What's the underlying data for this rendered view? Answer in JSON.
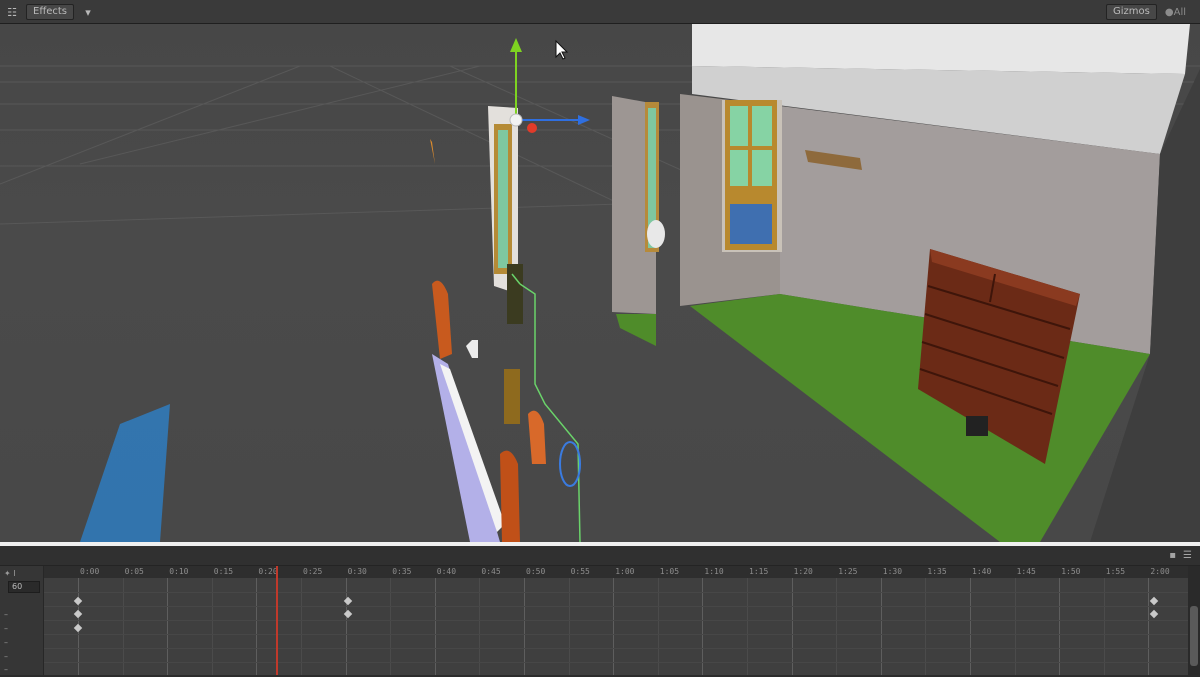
{
  "toolbar": {
    "effects_label": "Effects",
    "layers_label": "Gizmos",
    "search_placeholder": "●All"
  },
  "timeline": {
    "frame_value": "60",
    "ticks": [
      "0:00",
      "0:05",
      "0:10",
      "0:15",
      "0:20",
      "0:25",
      "0:30",
      "0:35",
      "0:40",
      "0:45",
      "0:50",
      "0:55",
      "1:00",
      "1:05",
      "1:10",
      "1:15",
      "1:20",
      "1:25",
      "1:30",
      "1:35",
      "1:40",
      "1:45",
      "1:50",
      "1:55",
      "2:00"
    ],
    "playhead_time": "0:20"
  },
  "colors": {
    "playhead": "#c0392b",
    "gizmo_y": "#7ed321",
    "gizmo_x": "#e03b2a",
    "gizmo_z": "#2f6fe0"
  }
}
